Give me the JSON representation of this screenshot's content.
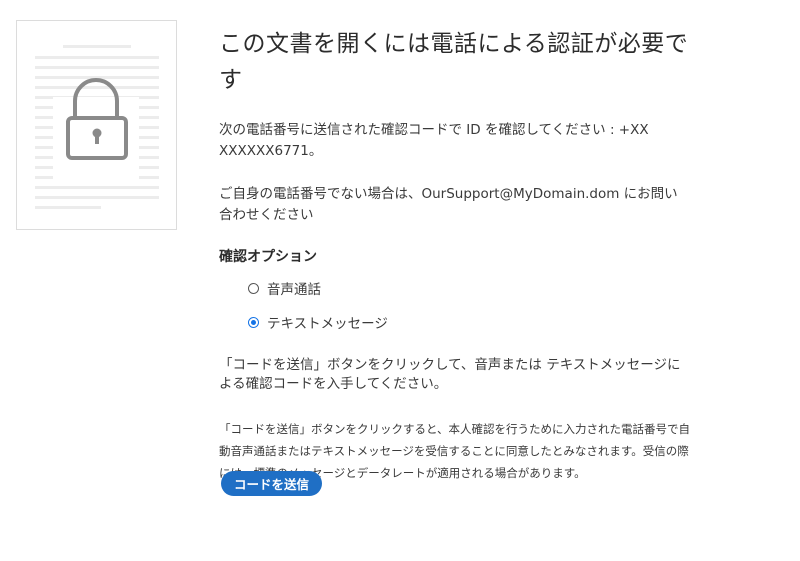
{
  "header": {
    "title": "この文書を開くには電話による認証が必要です"
  },
  "body": {
    "phone_instruction": "次の電話番号に送信された確認コードで ID を確認してください : +XX XXXXXX6771。",
    "support_note": "ご自身の電話番号でない場合は、OurSupport@MyDomain.dom にお問い合わせください"
  },
  "options": {
    "heading": "確認オプション",
    "items": [
      {
        "label": "音声通話",
        "selected": false
      },
      {
        "label": "テキストメッセージ",
        "selected": true
      }
    ]
  },
  "instructions": {
    "send_hint": "「コードを送信」ボタンをクリックして、音声または テキストメッセージによる確認コードを入手してください。",
    "consent": "「コードを送信」ボタンをクリックすると、本人確認を行うために入力された電話番号で自動音声通話またはテキストメッセージを受信することに同意したとみなされます。受信の際には、標準のメッセージとデータレートが適用される場合があります。"
  },
  "actions": {
    "send_code_label": "コードを送信"
  },
  "colors": {
    "accent": "#1f6fc5",
    "radio_selected": "#1473e6"
  },
  "icons": {
    "document": "locked-document-icon"
  }
}
